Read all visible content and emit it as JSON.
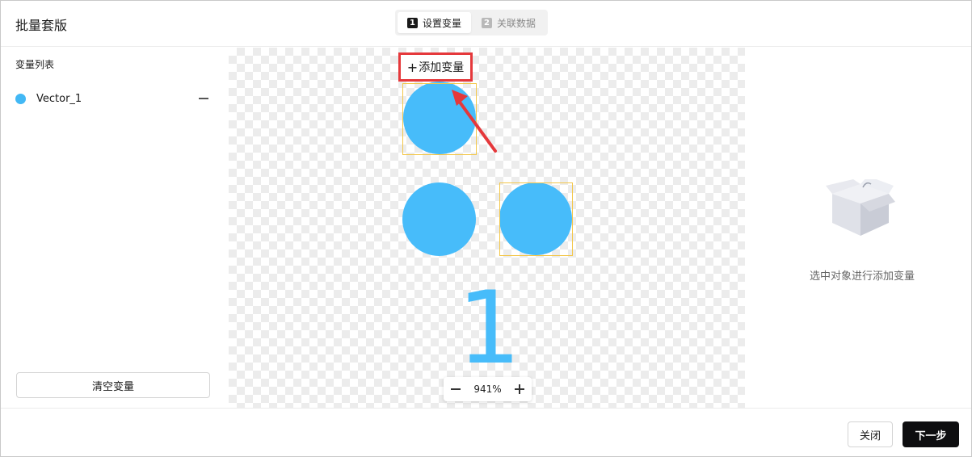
{
  "header": {
    "title": "批量套版",
    "steps": [
      {
        "num": "1",
        "label": "设置变量"
      },
      {
        "num": "2",
        "label": "关联数据"
      }
    ]
  },
  "sidebar": {
    "title": "变量列表",
    "variables": [
      {
        "name": "Vector_1",
        "color": "#42b8f5"
      }
    ],
    "clear_label": "清空变量"
  },
  "canvas": {
    "add_variable_label": "添加变量",
    "add_variable_symbol": "+",
    "big_number": "1",
    "zoom_level": "941%",
    "shape_color": "#47bcfa",
    "selection_color": "#f3c74a",
    "highlight_color": "#e5383b"
  },
  "right_panel": {
    "empty_text": "选中对象进行添加变量"
  },
  "footer": {
    "close_label": "关闭",
    "next_label": "下一步"
  }
}
